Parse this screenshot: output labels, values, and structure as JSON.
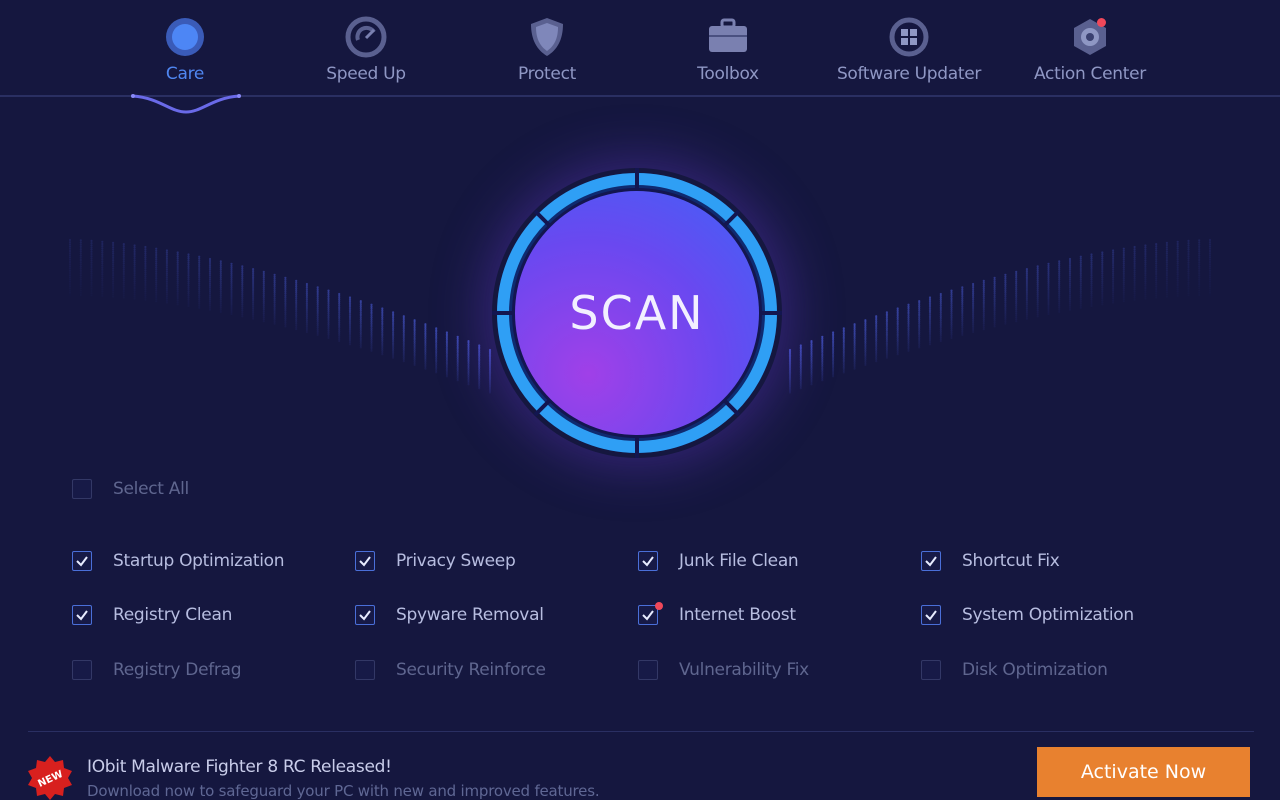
{
  "nav": [
    {
      "label": "Care",
      "icon": "care-icon",
      "active": true
    },
    {
      "label": "Speed Up",
      "icon": "speedometer-icon"
    },
    {
      "label": "Protect",
      "icon": "shield-icon"
    },
    {
      "label": "Toolbox",
      "icon": "briefcase-icon"
    },
    {
      "label": "Software Updater",
      "icon": "updater-icon"
    },
    {
      "label": "Action Center",
      "icon": "action-center-icon",
      "notification": true
    }
  ],
  "scan": {
    "label": "SCAN"
  },
  "select_all": {
    "label": "Select All",
    "checked": false
  },
  "options": [
    {
      "label": "Startup Optimization",
      "checked": true
    },
    {
      "label": "Privacy Sweep",
      "checked": true
    },
    {
      "label": "Junk File Clean",
      "checked": true
    },
    {
      "label": "Shortcut Fix",
      "checked": true
    },
    {
      "label": "Registry Clean",
      "checked": true
    },
    {
      "label": "Spyware Removal",
      "checked": true
    },
    {
      "label": "Internet Boost",
      "checked": true,
      "notification": true
    },
    {
      "label": "System Optimization",
      "checked": true
    },
    {
      "label": "Registry Defrag",
      "checked": false,
      "disabled": true
    },
    {
      "label": "Security Reinforce",
      "checked": false,
      "disabled": true
    },
    {
      "label": "Vulnerability Fix",
      "checked": false,
      "disabled": true
    },
    {
      "label": "Disk Optimization",
      "checked": false,
      "disabled": true
    }
  ],
  "news": {
    "badge": "NEW",
    "title": "IObit Malware Fighter 8 RC Released!",
    "subtitle": "Download now to safeguard your PC with new and improved features."
  },
  "activate_label": "Activate Now",
  "colors": {
    "background": "#15173f",
    "accent": "#4f86f0",
    "activate": "#e8812f",
    "ring": "#2f9ff5"
  }
}
